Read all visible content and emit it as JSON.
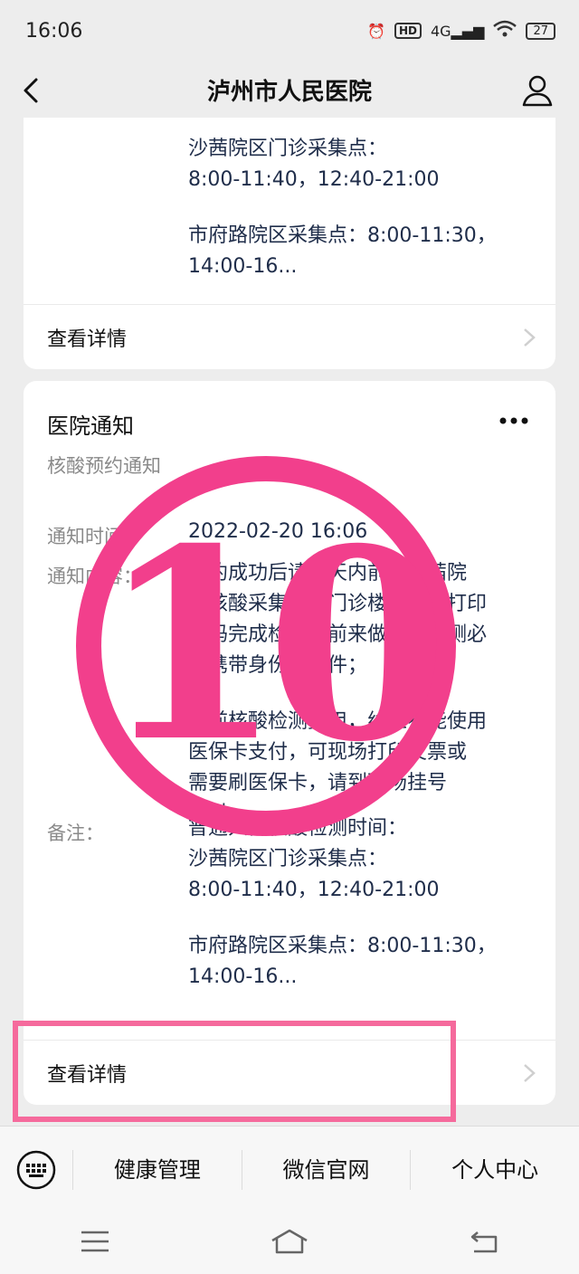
{
  "status_bar": {
    "time": "16:06",
    "network": "4G",
    "hd": "HD",
    "battery": "27"
  },
  "nav": {
    "title": "泸州市人民医院"
  },
  "card1": {
    "lines": [
      "沙茜院区门诊采集点：",
      "8:00-11:40，12:40-21:00",
      "市府路院区采集点：8:00-11:30，",
      "14:00-16..."
    ],
    "detail_label": "查看详情"
  },
  "card2": {
    "title": "医院通知",
    "subtitle": "核酸预约通知",
    "time_label": "通知时间：",
    "time_value": "2022-02-20 16:06",
    "content_label": "通知内容：",
    "content_lines": [
      "预约成功后请三天内前往沙茜院",
      "区核酸采集点（门诊楼门外）打印",
      "条码完成检测；前来做核酸检测必",
      "须携带身份证原件；",
      "目前核酸检测费用，线上不能使用",
      "医保卡支付，可现场打印发票或",
      "需要刷医保卡，请到现场挂号",
      "支付。"
    ],
    "note_label": "备注：",
    "note_lines": [
      "普通人群核酸检测时间：",
      "沙茜院区门诊采集点：",
      "8:00-11:40，12:40-21:00",
      "市府路院区采集点：8:00-11:30，",
      "14:00-16..."
    ],
    "detail_label": "查看详情"
  },
  "bottom_menu": {
    "items": [
      "健康管理",
      "微信官网",
      "个人中心"
    ]
  },
  "annotation": {
    "number": "10",
    "color": "#f23f8c"
  }
}
